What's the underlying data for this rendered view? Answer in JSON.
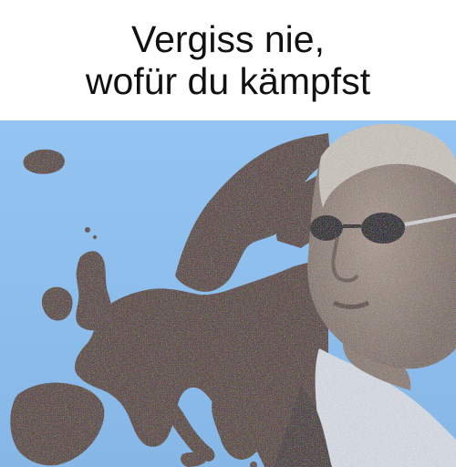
{
  "caption": {
    "line1": "Vergiss nie,",
    "line2": "wofür du kämpfst"
  },
  "image": {
    "map_region": "europe-map",
    "person": "man-with-tinted-glasses",
    "sea_color": "#8fc0ef",
    "land_color": "#5a4a48",
    "skin_color": "#9c8f86",
    "hair_color": "#c8c2bb",
    "shirt_color": "#d9dde4"
  }
}
